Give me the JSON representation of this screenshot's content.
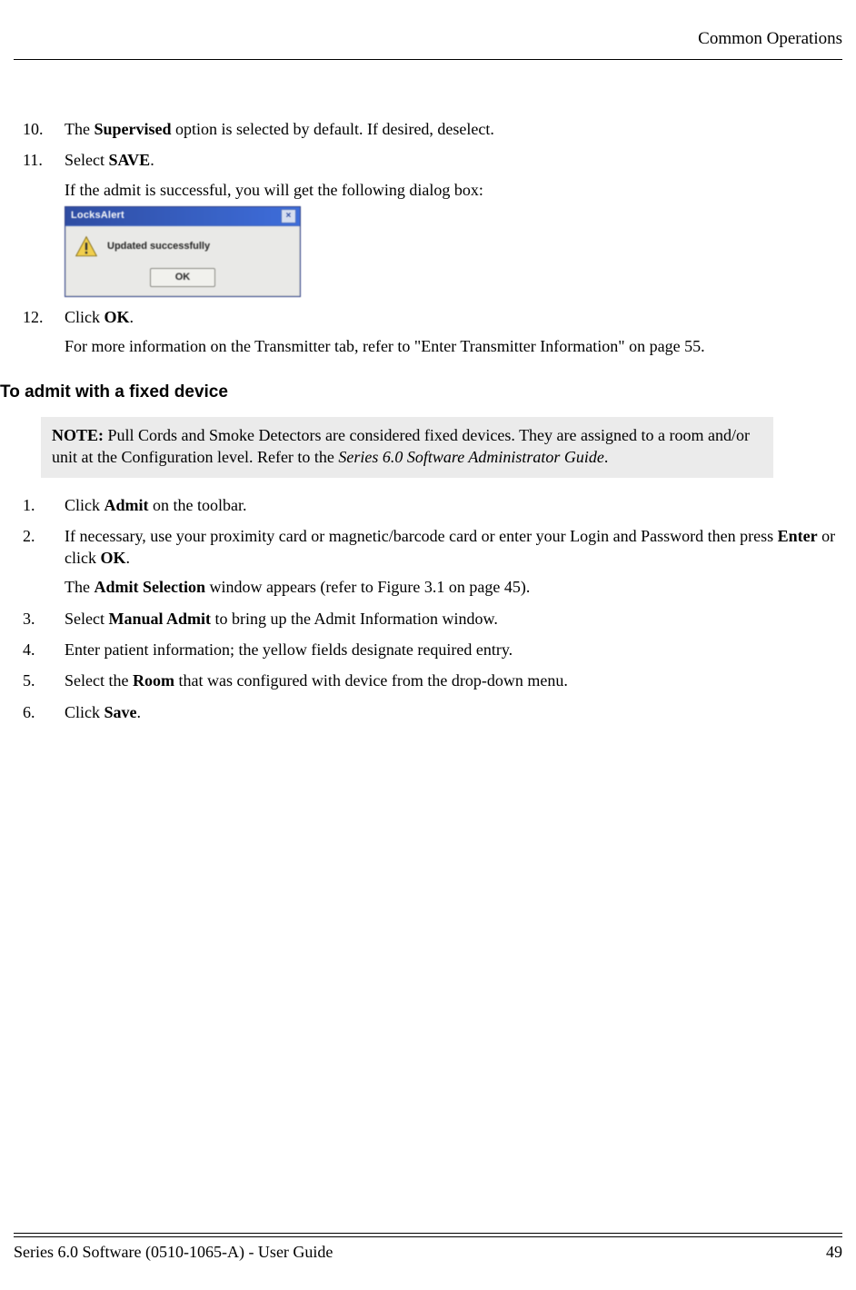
{
  "header": {
    "section_title": "Common Operations"
  },
  "list_top": [
    {
      "num": "10.",
      "prefix": "The ",
      "bold1": "Supervised",
      "suffix": " option is selected by default. If desired, deselect."
    },
    {
      "num": "11.",
      "prefix": "Select ",
      "bold1": "SAVE",
      "suffix": ".",
      "para": "If the admit is successful, you will get the following dialog box:"
    }
  ],
  "dialog": {
    "title": "LocksAlert",
    "close_glyph": "×",
    "message": "Updated successfully",
    "ok_label": "OK"
  },
  "list_mid": {
    "num": "12.",
    "prefix": "Click ",
    "bold1": "OK",
    "suffix": ".",
    "para": "For more information on the Transmitter tab, refer to \"Enter Transmitter Information\" on page 55."
  },
  "subheading": "To admit with a fixed device",
  "note": {
    "label": "NOTE:",
    "text_before_italic": " Pull Cords and Smoke Detectors are considered fixed devices. They are assigned to a room and/or unit at the Configuration level. Refer to the ",
    "italic": "Series 6.0 Software Administrator Guide",
    "text_after_italic": "."
  },
  "list_bottom": [
    {
      "num": "1.",
      "segments": [
        {
          "t": "Click "
        },
        {
          "t": "Admit",
          "b": true
        },
        {
          "t": " on the toolbar."
        }
      ]
    },
    {
      "num": "2.",
      "segments": [
        {
          "t": "If necessary, use your proximity card or magnetic/barcode card or enter your Login and Password then press "
        },
        {
          "t": "Enter",
          "b": true
        },
        {
          "t": " or click "
        },
        {
          "t": "OK",
          "b": true
        },
        {
          "t": "."
        }
      ],
      "para_segments": [
        {
          "t": "The "
        },
        {
          "t": "Admit Selection",
          "b": true
        },
        {
          "t": " window appears (refer to Figure 3.1 on page 45)."
        }
      ]
    },
    {
      "num": "3.",
      "segments": [
        {
          "t": "Select "
        },
        {
          "t": "Manual Admit",
          "b": true
        },
        {
          "t": " to bring up the Admit Information window."
        }
      ]
    },
    {
      "num": "4.",
      "segments": [
        {
          "t": "Enter patient information; the yellow fields designate required entry."
        }
      ]
    },
    {
      "num": "5.",
      "segments": [
        {
          "t": "Select the "
        },
        {
          "t": "Room",
          "b": true
        },
        {
          "t": " that was configured with device from the drop-down menu."
        }
      ]
    },
    {
      "num": "6.",
      "segments": [
        {
          "t": "Click "
        },
        {
          "t": "Save",
          "b": true
        },
        {
          "t": "."
        }
      ]
    }
  ],
  "footer": {
    "left": "Series 6.0 Software (0510-1065-A) - User Guide",
    "right": "49"
  }
}
